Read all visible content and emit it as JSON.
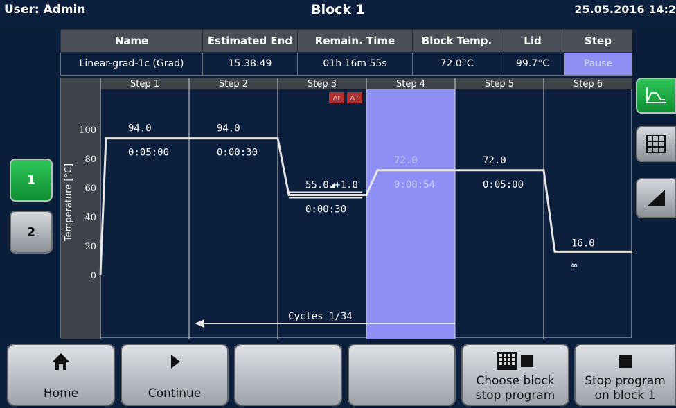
{
  "header": {
    "user": "User: Admin",
    "title": "Block 1",
    "datetime": "25.05.2016  14:2"
  },
  "status_table": {
    "headers": [
      "Name",
      "Estimated End",
      "Remain. Time",
      "Block Temp.",
      "Lid",
      "Step"
    ],
    "values": [
      "Linear-grad-1c (Grad)",
      "15:38:49",
      "01h 16m 55s",
      "72.0°C",
      "99.7°C",
      "Pause"
    ]
  },
  "blocks": [
    "1",
    "2"
  ],
  "chart_data": {
    "type": "line",
    "ylabel": "Temperature [°C]",
    "yticks": [
      "100",
      "80",
      "60",
      "40",
      "20",
      "0"
    ],
    "ylim": [
      0,
      100
    ],
    "steps": [
      {
        "label": "Step 1",
        "temp": "94.0",
        "time": "0:05:00"
      },
      {
        "label": "Step 2",
        "temp": "94.0",
        "time": "0:00:30"
      },
      {
        "label": "Step 3",
        "temp": "55.0◢+1.0",
        "time": "0:00:30"
      },
      {
        "label": "Step 4",
        "temp": "72.0",
        "time": "0:00:54"
      },
      {
        "label": "Step 5",
        "temp": "72.0",
        "time": "0:05:00"
      },
      {
        "label": "Step 6",
        "temp": "16.0",
        "time": "∞"
      }
    ],
    "series": [
      {
        "values": [
          94.0,
          94.0,
          55.0,
          72.0,
          72.0,
          16.0
        ]
      }
    ],
    "start_temp": 0,
    "highlighted_step": 4,
    "cycles_label": "Cycles 1/34",
    "step3_badges": [
      "Δt",
      "ΔT"
    ],
    "colors": {
      "highlight": "#8e8ff5",
      "line": "#e6e6e6",
      "badge": "#b33030"
    }
  },
  "side_icons": [
    "profile-graph-icon",
    "table-grid-icon",
    "ramp-icon"
  ],
  "bottom_buttons": [
    {
      "icon": "home-icon",
      "label": "Home"
    },
    {
      "icon": "play-icon",
      "label": "Continue"
    },
    {
      "icon": "",
      "label": ""
    },
    {
      "icon": "",
      "label": ""
    },
    {
      "icon": "block-grid-stop-icon",
      "label": "Choose block\nstop program"
    },
    {
      "icon": "stop-icon",
      "label": "Stop program\non block 1"
    }
  ]
}
